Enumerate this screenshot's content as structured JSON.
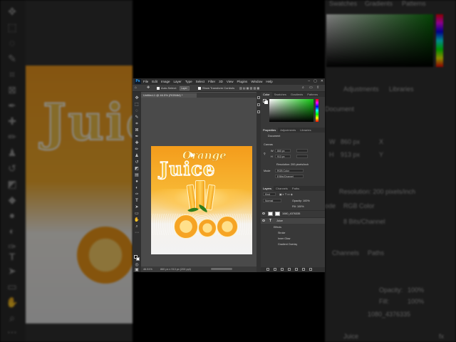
{
  "background_left": {
    "canvas_word": "Juice"
  },
  "background_right": {
    "tabs": [
      "Swatches",
      "Gradients",
      "Patterns"
    ],
    "adjustments_tab": "Adjustments",
    "libraries_tab": "Libraries",
    "document_label": "Document",
    "width_label": "W",
    "width_value": "860 px",
    "height_label": "H",
    "height_value": "913 px",
    "x_label": "X",
    "y_label": "Y",
    "resolution": "Resolution: 200 pixels/inch",
    "mode_label": "ode",
    "mode_value": "RGB Color",
    "depth_value": "8 Bits/Channel",
    "channels_tab": "Channels",
    "paths_tab": "Paths",
    "opacity_label": "Opacity:",
    "opacity_value": "100%",
    "fill_label": "Fill:",
    "fill_value": "100%",
    "layer_image_name": "1080_4376335",
    "layer_text_name": "Juice",
    "fx_label": "fx"
  },
  "app": {
    "logo": "Ps",
    "menu": [
      "File",
      "Edit",
      "Image",
      "Layer",
      "Type",
      "Select",
      "Filter",
      "3D",
      "View",
      "Plugins",
      "Window",
      "Help"
    ],
    "window_controls": [
      "–",
      "▢",
      "✕"
    ]
  },
  "options_bar": {
    "auto_select_label": "Auto-Select:",
    "auto_select_target": "Layer",
    "show_transform_label": "Show Transform Controls"
  },
  "document": {
    "tab_title": "Untitled-1 @ 46.5% (RGB/8#) *",
    "artwork_word_top": "Orange",
    "artwork_word_main": "Juice",
    "zoom": "46.51%",
    "dimensions": "860 px x 913 px (200 ppi)"
  },
  "right_panel": {
    "color_tabs": [
      "Color",
      "Swatches",
      "Gradients",
      "Patterns"
    ],
    "properties_tabs": [
      "Properties",
      "Adjustments",
      "Libraries"
    ],
    "document_label": "Document",
    "canvas_label": "Canvas",
    "w_label": "W",
    "w_value": "860 px",
    "h_label": "H",
    "h_value": "913 px",
    "resolution": "Resolution: 200 pixels/inch",
    "mode_label": "Mode",
    "mode_value": "RGB Color",
    "depth_value": "8 Bits/Channel",
    "layers_tabs": [
      "Layers",
      "Channels",
      "Paths"
    ],
    "kind_filter": "Kind",
    "blend_mode": "Normal",
    "opacity": "Opacity: 100%",
    "fill": "Fill: 100%",
    "layers": [
      {
        "name": "1080_4376335",
        "type": "image"
      },
      {
        "name": "Juice",
        "type": "text"
      }
    ],
    "effects_label": "Effects",
    "effects": [
      "Stroke",
      "Inner Glow",
      "Gradient Overlay"
    ]
  },
  "colors": {
    "ps_blue": "#31a8ff",
    "orange": "#f49c1b",
    "panel_bg": "#383838"
  }
}
